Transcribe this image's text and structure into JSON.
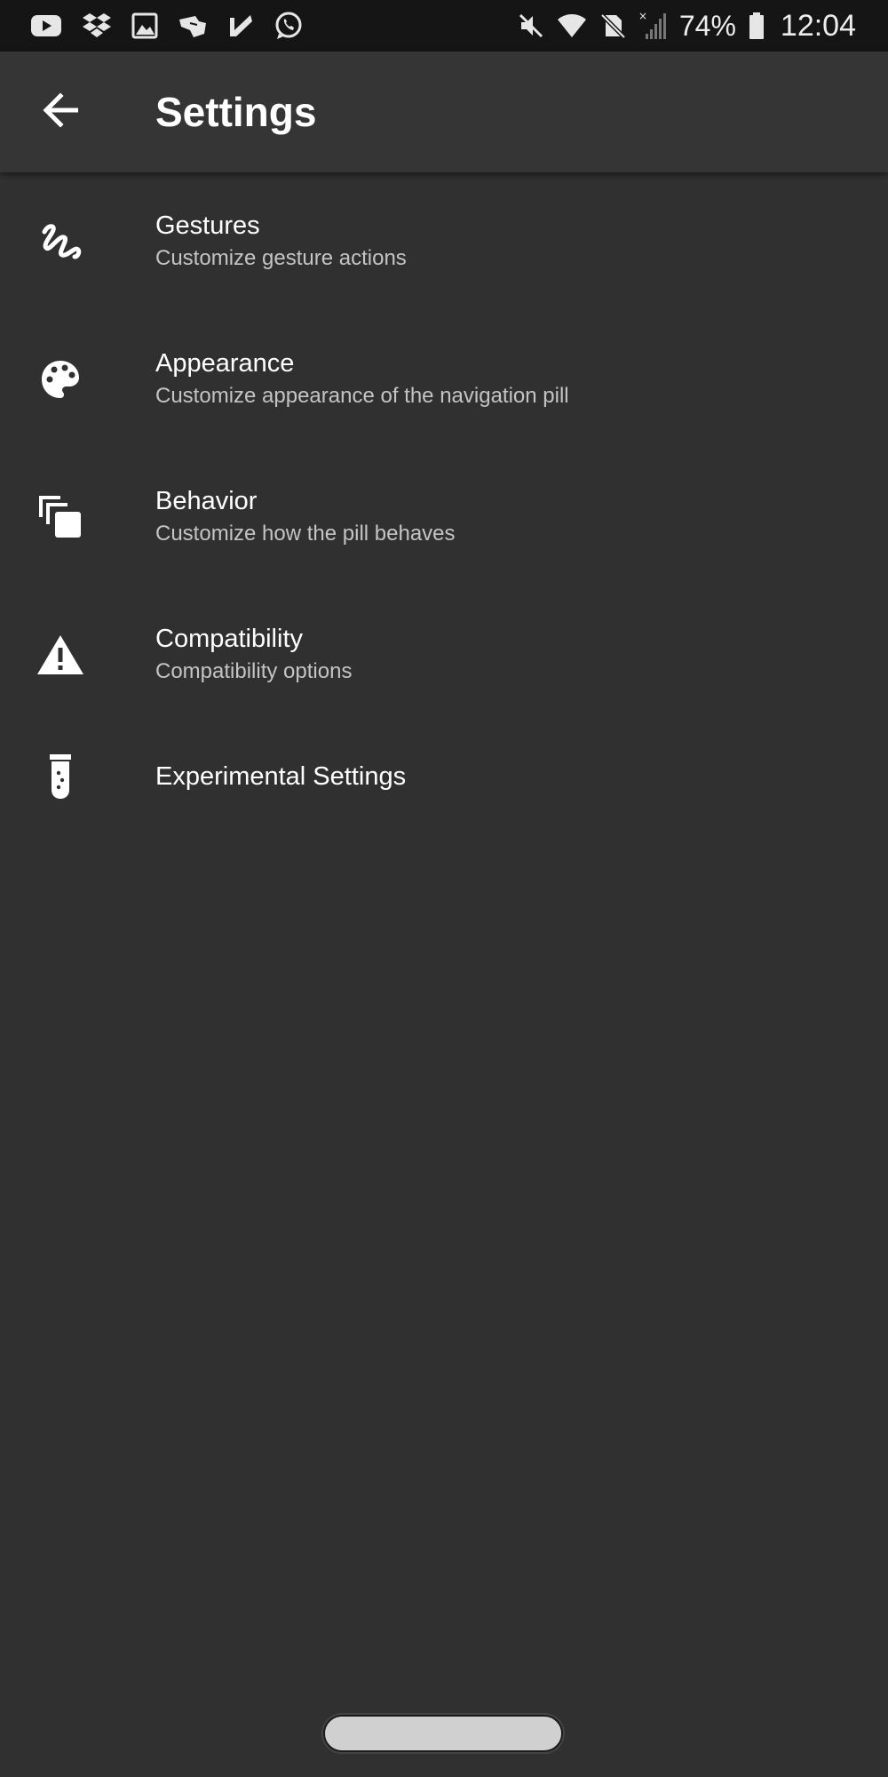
{
  "status_bar": {
    "left_icons": [
      "youtube-icon",
      "dropbox-icon",
      "gallery-icon",
      "hand-icon",
      "checkmark-app-icon",
      "whatsapp-icon"
    ],
    "right_icons": [
      "mute-icon",
      "wifi-icon",
      "no-sim-icon",
      "signal-icon",
      "battery-icon"
    ],
    "battery": "74%",
    "time": "12:04"
  },
  "app_bar": {
    "back_icon": "arrow-back-icon",
    "title": "Settings"
  },
  "settings": {
    "items": [
      {
        "icon": "gesture-icon",
        "title": "Gestures",
        "subtitle": "Customize gesture actions"
      },
      {
        "icon": "palette-icon",
        "title": "Appearance",
        "subtitle": "Customize appearance of the navigation pill"
      },
      {
        "icon": "layers-icon",
        "title": "Behavior",
        "subtitle": "Customize how the pill behaves"
      },
      {
        "icon": "warning-icon",
        "title": "Compatibility",
        "subtitle": "Compatibility options"
      },
      {
        "icon": "test-tube-icon",
        "title": "Experimental Settings"
      }
    ]
  },
  "colors": {
    "background": "#303030",
    "app_bar": "#353535",
    "status_bar": "#151515",
    "title_text": "#ffffff",
    "subtitle_text": "#c4c4c4",
    "nav_pill": "#d0d0d0"
  }
}
